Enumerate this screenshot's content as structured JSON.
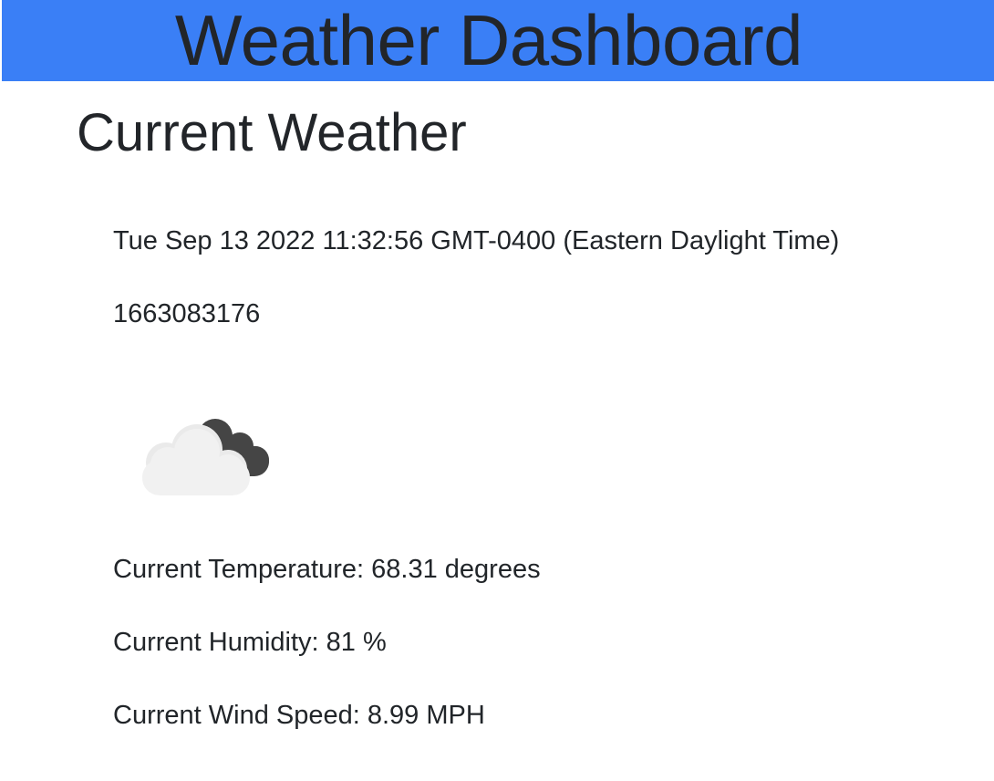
{
  "header": {
    "title": "Weather Dashboard",
    "background_color": "#3a7ff6"
  },
  "current": {
    "heading": "Current Weather",
    "date_string": "Tue Sep 13 2022 11:32:56 GMT-0400 (Eastern Daylight Time)",
    "unix_timestamp": "1663083176",
    "icon": "broken-clouds-icon",
    "temperature_text": "Current Temperature: 68.31 degrees",
    "humidity_text": "Current Humidity: 81 %",
    "wind_speed_text": "Current Wind Speed: 8.99 MPH"
  }
}
